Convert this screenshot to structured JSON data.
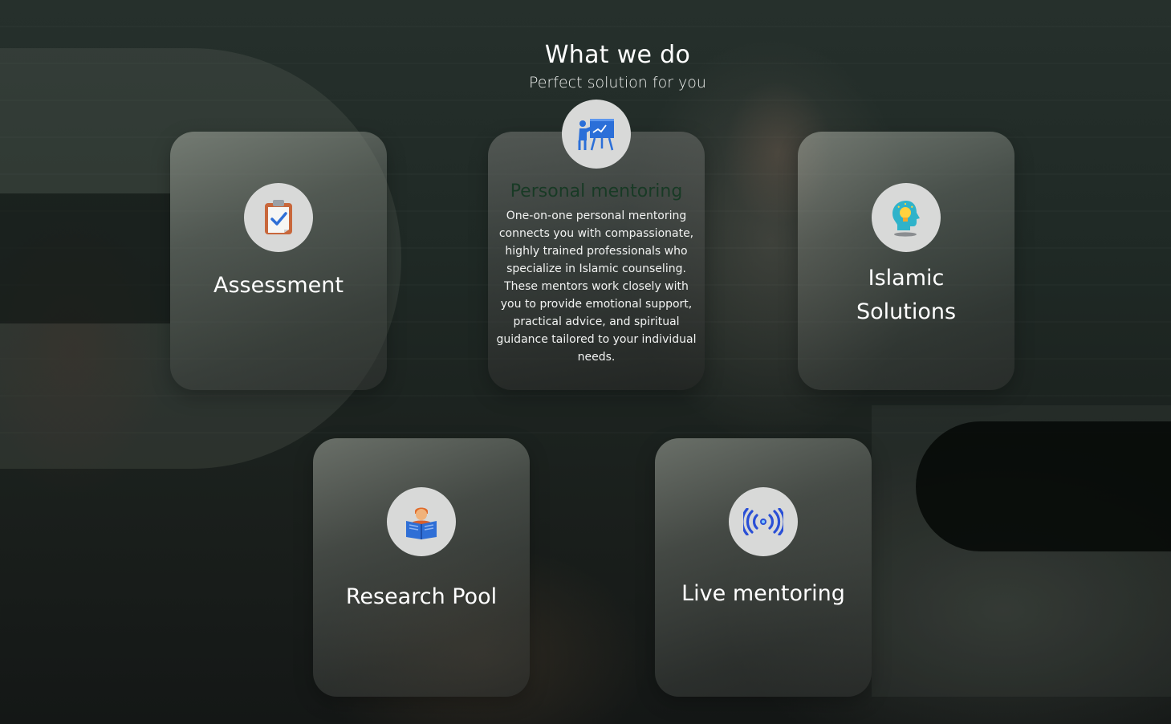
{
  "section": {
    "title": "What we do",
    "subtitle": "Perfect solution for you"
  },
  "cards": [
    {
      "title": "Assessment",
      "icon": "clipboard-check-icon"
    },
    {
      "title": "Personal mentoring",
      "icon": "presentation-teacher-icon",
      "description": "One-on-one personal mentoring connects you with compassionate, highly trained professionals who specialize in Islamic counseling. These mentors work closely with you to provide emotional support, practical advice, and spiritual guidance tailored to your individual needs."
    },
    {
      "title_line1": "Islamic",
      "title_line2": "Solutions",
      "icon": "head-lightbulb-icon"
    },
    {
      "title": "Research Pool",
      "icon": "person-reading-book-icon"
    },
    {
      "title": "Live mentoring",
      "icon": "broadcast-signal-icon"
    }
  ],
  "colors": {
    "highlight_title": "#183a25",
    "icon_circle": "#d8d9d8"
  }
}
